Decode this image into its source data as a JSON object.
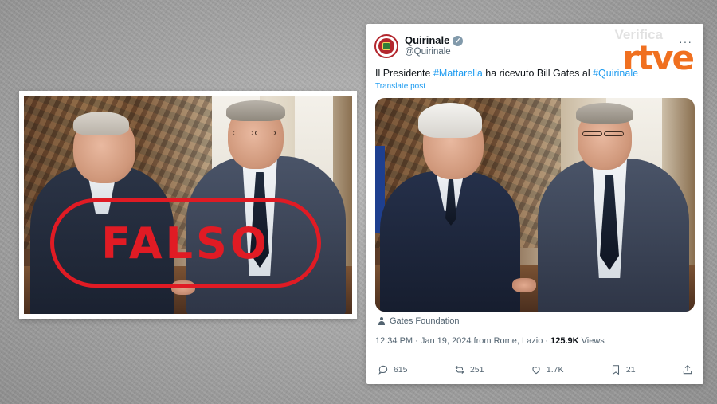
{
  "left_image": {
    "stamp_text": "FALSO"
  },
  "watermark": {
    "verifica": "Verifica",
    "brand": "rtve"
  },
  "tweet": {
    "author_name": "Quirinale",
    "author_handle": "@Quirinale",
    "verified": true,
    "text_parts": {
      "p1": "Il Presidente ",
      "tag1": "#Mattarella",
      "p2": " ha ricevuto Bill Gates al ",
      "tag2": "#Quirinale"
    },
    "translate_label": "Translate post",
    "photo_credit": "Gates Foundation",
    "meta": {
      "time_location": "12:34 PM · Jan 19, 2024 from Rome, Lazio · ",
      "views_count": "125.9K",
      "views_label": " Views"
    },
    "actions": {
      "replies": "615",
      "reposts": "251",
      "likes": "1.7K",
      "bookmarks": "21"
    }
  },
  "colors": {
    "stamp_red": "#e01b24",
    "link_blue": "#1d9bf0",
    "rtve_orange": "#f07020"
  }
}
